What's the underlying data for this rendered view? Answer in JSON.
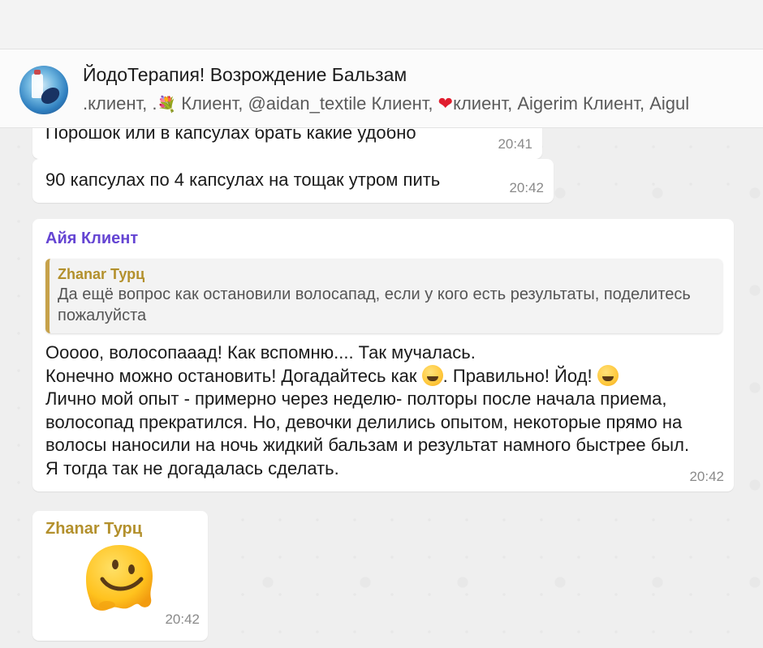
{
  "header": {
    "title": "ЙодоТерапия! Возрождение Бальзам",
    "members_part1": ".клиент, .",
    "members_flower": "💐",
    "members_part2": " Клиент, @aidan_textile Клиент, ",
    "members_heart": "❤",
    "members_part3": "клиент, Aigerim Клиент, Aigul"
  },
  "messages": [
    {
      "text": "Порошок или в  капсулах брать какие удобно",
      "time": "20:41"
    },
    {
      "text": "90 капсулах по 4 капсулах на тощак утром пить",
      "time": "20:42"
    },
    {
      "sender": "Айя Клиент",
      "sender_color": "#6545d3",
      "quote": {
        "author": "Zhanar Турц",
        "text": "Да ещё вопрос как остановили волосапад, если у кого есть результаты, поделитесь пожалуйста"
      },
      "line1": "Ооооо, волосопааад! Как вспомню.... Так мучалась.",
      "line2a": "Конечно можно остановить! Догадайтесь как ",
      "line2b": ". Правильно! Йод! ",
      "line3": "Лично мой опыт - примерно через неделю- полторы после начала приема, волосопад прекратился. Но, девочки делились опытом, некоторые прямо на волосы наносили на ночь жидкий бальзам и результат намного быстрее был. Я тогда так не догадалась сделать.",
      "time": "20:42"
    },
    {
      "sender": "Zhanar Турц",
      "sender_color": "#b3902c",
      "sticker": "melting-face",
      "time": "20:42"
    }
  ]
}
